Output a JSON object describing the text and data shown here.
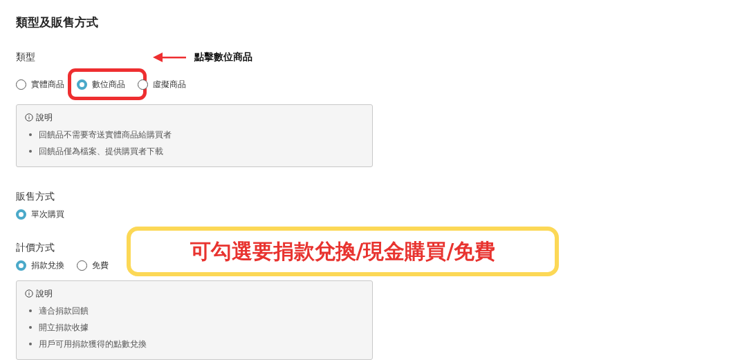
{
  "title": "類型及販售方式",
  "sections": [
    {
      "label": "類型",
      "options": [
        {
          "label": "實體商品",
          "selected": false,
          "highlighted": false
        },
        {
          "label": "數位商品",
          "selected": true,
          "highlighted": true
        },
        {
          "label": "虛擬商品",
          "selected": false,
          "highlighted": false
        }
      ],
      "note": {
        "title": "說明",
        "items": [
          "回饋品不需要寄送實體商品給購買者",
          "回饋品僅為檔案、提供購買者下載"
        ]
      }
    },
    {
      "label": "販售方式",
      "options": [
        {
          "label": "單次購買",
          "selected": true,
          "highlighted": false
        }
      ]
    },
    {
      "label": "計價方式",
      "options": [
        {
          "label": "捐款兌換",
          "selected": true,
          "highlighted": false
        },
        {
          "label": "免費",
          "selected": false,
          "highlighted": false
        }
      ],
      "note": {
        "title": "說明",
        "items": [
          "適合捐款回饋",
          "開立捐款收據",
          "用戶可用捐款獲得的點數兌換"
        ]
      }
    }
  ],
  "annotations": {
    "pointer": "點擊數位商品",
    "callout": "可勾選要捐款兌換/現金購買/免費"
  }
}
